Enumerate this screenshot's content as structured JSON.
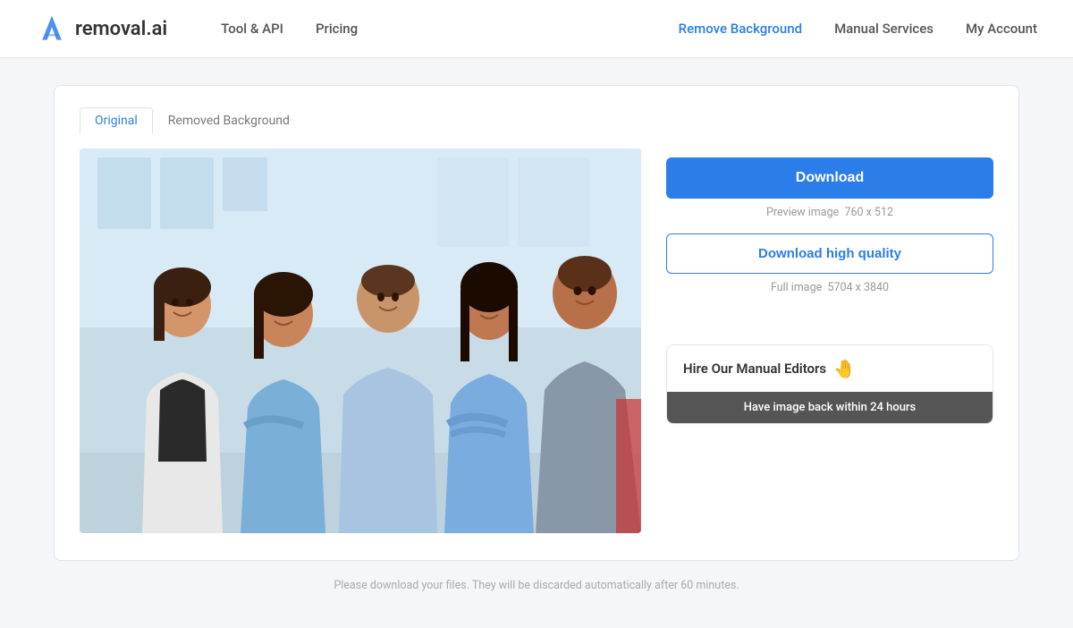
{
  "header": {
    "logo_text": "removal.ai",
    "nav_left": [
      {
        "label": "Tool & API",
        "href": "#"
      },
      {
        "label": "Pricing",
        "href": "#"
      }
    ],
    "nav_right": [
      {
        "label": "Remove Background",
        "href": "#",
        "active": true
      },
      {
        "label": "Manual Services",
        "href": "#",
        "active": false
      },
      {
        "label": "My Account",
        "href": "#",
        "active": false
      }
    ]
  },
  "tabs": [
    {
      "label": "Original",
      "active": true
    },
    {
      "label": "Removed Background",
      "active": false
    }
  ],
  "right_panel": {
    "download_btn": "Download",
    "preview_label": "Preview image",
    "preview_size": "760 x 512",
    "download_hq_btn": "Download high quality",
    "full_label": "Full image",
    "full_size": "5704 x 3840",
    "manual_editors_title": "Hire Our Manual Editors",
    "manual_editors_subtitle": "Have image back within 24 hours"
  },
  "footer": {
    "note": "Please download your files. They will be discarded automatically after 60 minutes."
  }
}
